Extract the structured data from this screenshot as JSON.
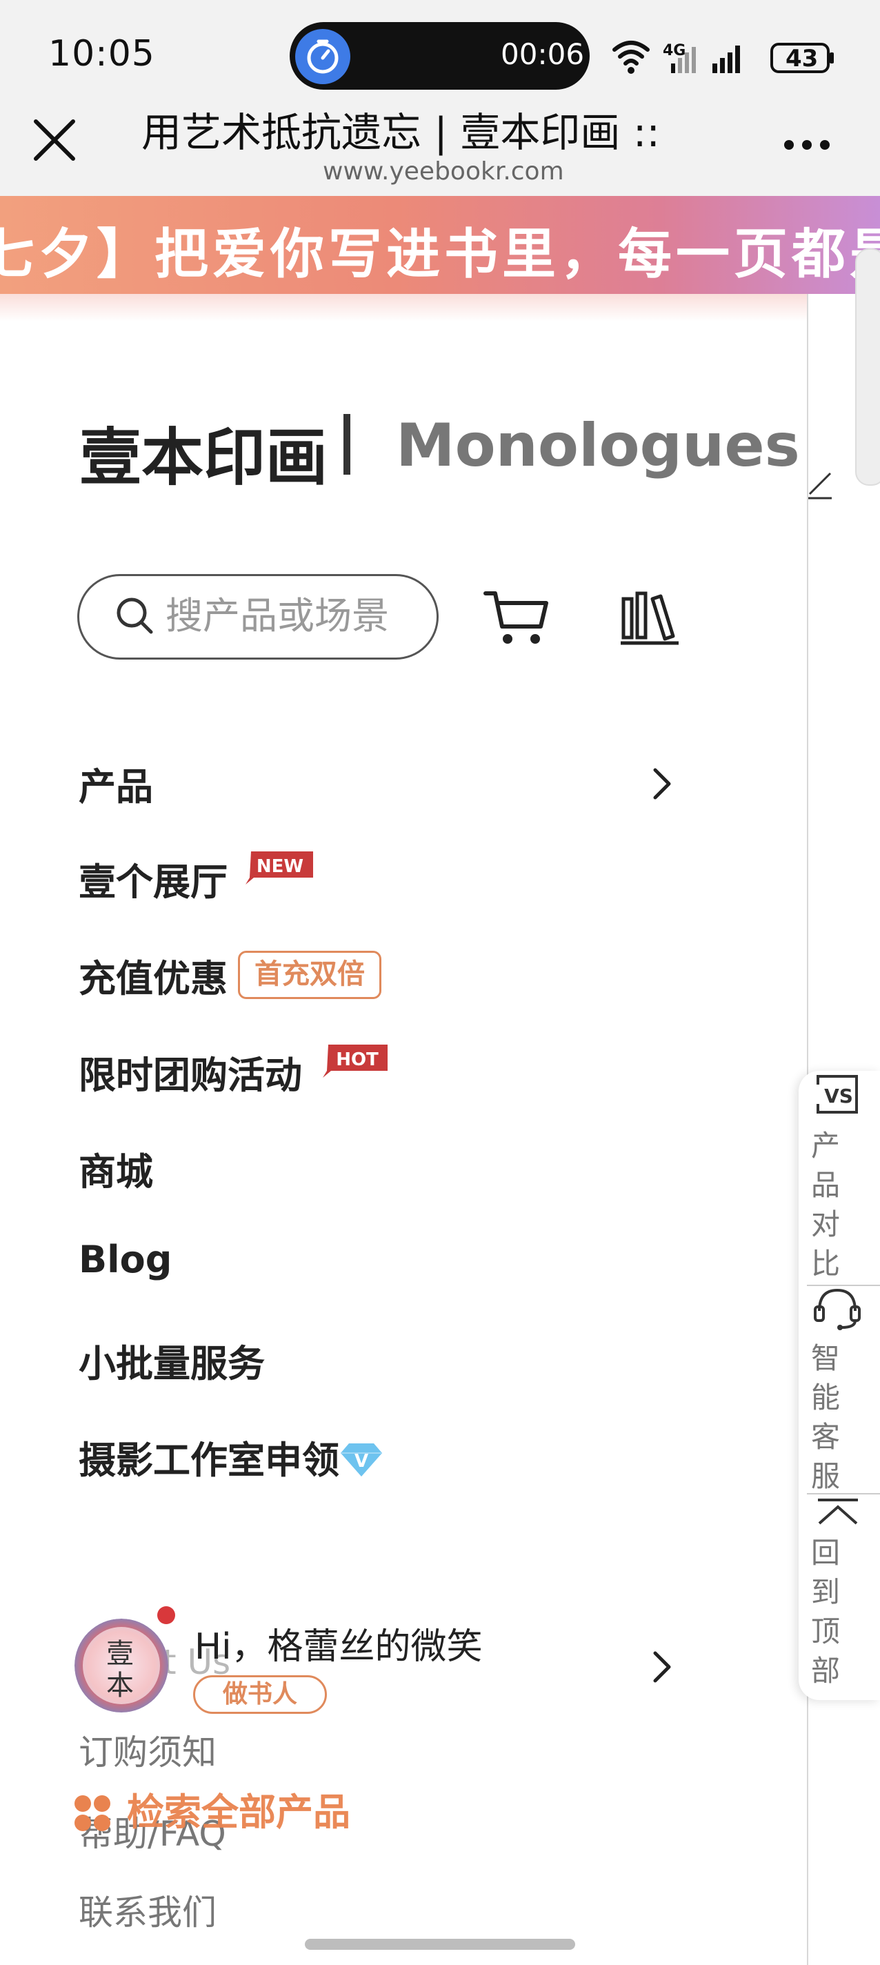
{
  "status_bar": {
    "time": "10:05",
    "timer": "00:06",
    "battery": "43",
    "network": "4G"
  },
  "browser": {
    "title": "用艺术抵抗遗忘 | 壹本印画 ::",
    "url": "www.yeebookr.com"
  },
  "banner": {
    "text": "夕】把爱你写进书里，每一页都是",
    "prefix_glyph": "七",
    "gradient": [
      "#f2a07e",
      "#c88fd6"
    ]
  },
  "brand": {
    "name": "壹本印画",
    "separator": "|",
    "subtitle": "Monologues"
  },
  "search": {
    "placeholder": "搜产品或场景"
  },
  "menu": {
    "items": [
      {
        "label": "产品"
      },
      {
        "label": "壹个展厅",
        "badge": "NEW"
      },
      {
        "label": "充值优惠",
        "badge": "首充双倍"
      },
      {
        "label": "限时团购活动",
        "badge": "HOT"
      },
      {
        "label": "商城"
      },
      {
        "label": "Blog"
      },
      {
        "label": "小批量服务"
      },
      {
        "label": "摄影工作室申领"
      }
    ]
  },
  "user": {
    "greeting": "Hi，格蕾丝的微笑",
    "tag": "做书人",
    "avatar_text": "壹本",
    "ghost_text": "t Us"
  },
  "footer": {
    "links": [
      "订购须知",
      "帮助/FAQ",
      "联系我们"
    ],
    "search_all": "检索全部产品"
  },
  "float_panel": {
    "compare": "产品对比",
    "compare_icon_text": "VS",
    "service": "智能客服",
    "top": "回到顶部"
  },
  "colors": {
    "accent_orange": "#e08a5c",
    "badge_red": "#c83a3a",
    "status_bg": "#f2f2f2"
  }
}
